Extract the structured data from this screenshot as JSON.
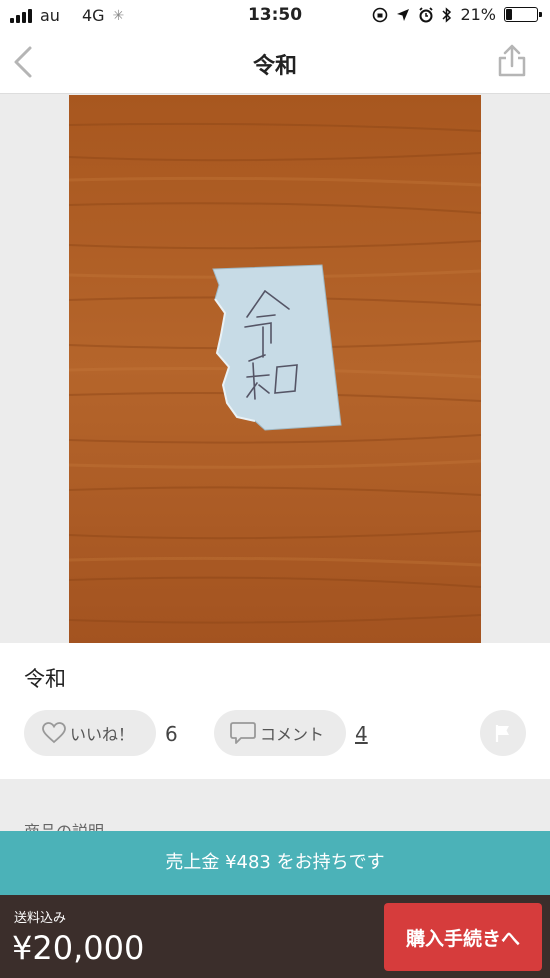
{
  "status_bar": {
    "carrier": "au",
    "network": "4G",
    "time": "13:50",
    "battery_text": "21%",
    "battery_level": 0.21
  },
  "nav": {
    "title": "令和"
  },
  "item": {
    "name": "令和",
    "like_label": "いいね！",
    "like_count": "6",
    "comment_label": "コメント",
    "comment_count": "4"
  },
  "description": {
    "section_label": "商品の説明"
  },
  "banner": {
    "text": "売上金 ¥483 をお持ちです"
  },
  "bottom_bar": {
    "shipping_label": "送料込み",
    "price": "¥20,000",
    "buy_label": "購入手続きへ"
  },
  "colors": {
    "banner": "#4bb2b8",
    "bottom_bar": "#3b2e2b",
    "buy_button": "#d63c3c"
  }
}
